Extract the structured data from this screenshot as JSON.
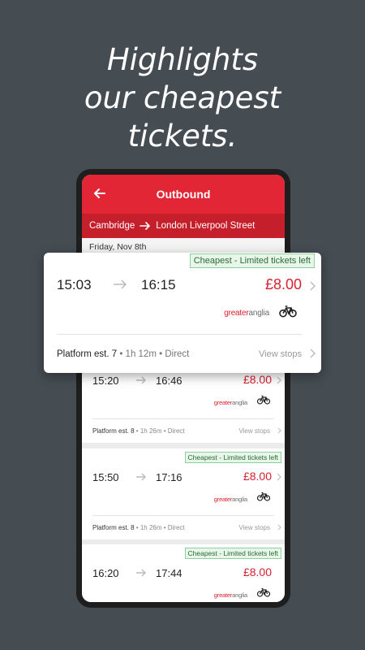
{
  "headline": [
    "Highlights",
    "our cheapest",
    "tickets."
  ],
  "appbar": {
    "title": "Outbound",
    "back_icon": "arrow-left-icon"
  },
  "route": {
    "from": "Cambridge",
    "to": "London Liverpool Street"
  },
  "date": "Friday, Nov 8th",
  "operator": {
    "part1": "greater",
    "part2": "anglia"
  },
  "colors": {
    "brand_red": "#e32636",
    "price_red": "#d8202f",
    "badge_green": "#e8f5e9",
    "background": "#454c52"
  },
  "featured": {
    "badge": "Cheapest - Limited tickets left",
    "depart": "15:03",
    "arrive": "16:15",
    "price": "£8.00",
    "platform": "Platform est. 7",
    "details": " • 1h 12m • Direct",
    "view_stops": "View stops"
  },
  "journeys": [
    {
      "badge": "",
      "depart": "15:20",
      "arrive": "16:46",
      "price": "£8.00",
      "platform": "Platform est. 8",
      "details": " • 1h 26m • Direct",
      "view_stops": "View stops"
    },
    {
      "badge": "Cheapest - Limited tickets left",
      "depart": "15:50",
      "arrive": "17:16",
      "price": "£8.00",
      "platform": "Platform est. 8",
      "details": " • 1h 26m • Direct",
      "view_stops": "View stops"
    },
    {
      "badge": "Cheapest - Limited tickets left",
      "depart": "16:20",
      "arrive": "17:44",
      "price": "£8.00",
      "platform": "",
      "details": "",
      "view_stops": ""
    }
  ]
}
